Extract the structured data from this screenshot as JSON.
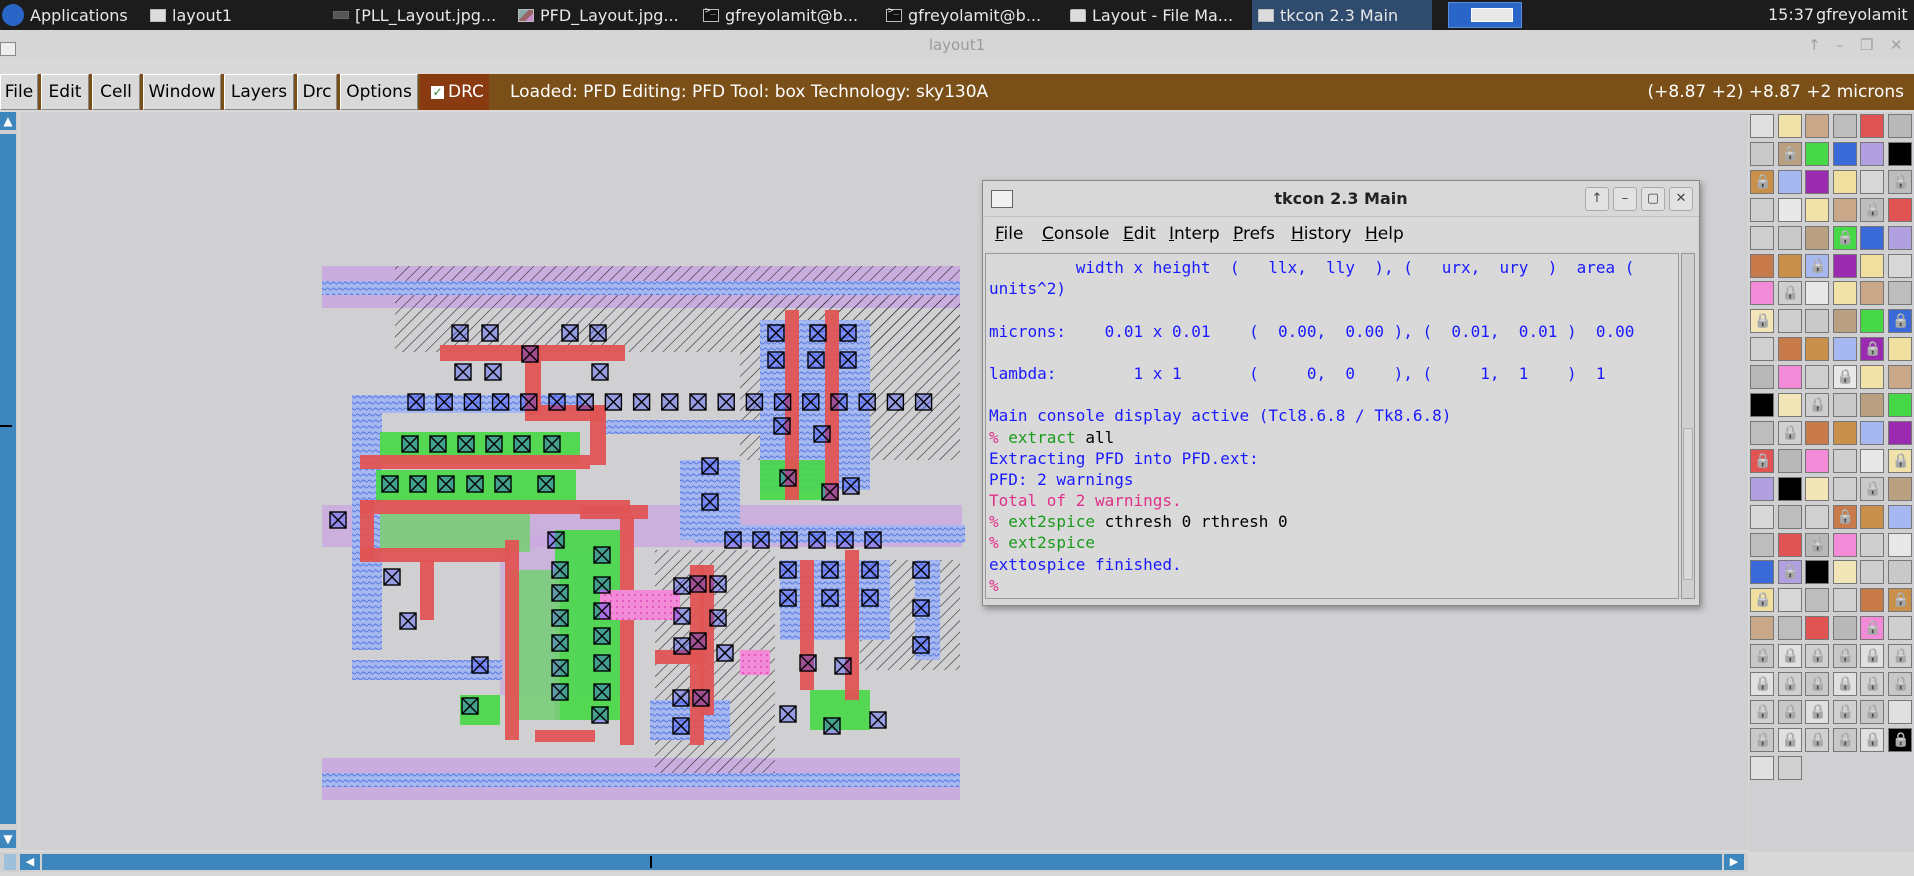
{
  "taskbar": {
    "applications": "Applications",
    "items": [
      {
        "label": "layout1",
        "icon": "window-icon"
      },
      {
        "label": "[PLL_Layout.jpg...",
        "icon": "window-icon"
      },
      {
        "label": "PFD_Layout.jpg...",
        "icon": "image-icon"
      },
      {
        "label": "gfreyolamit@b...",
        "icon": "terminal-icon"
      },
      {
        "label": "gfreyolamit@b...",
        "icon": "terminal-icon"
      },
      {
        "label": "Layout - File Ma...",
        "icon": "folder-icon"
      },
      {
        "label": "tkcon 2.3 Main",
        "icon": "window-icon",
        "active": true
      }
    ],
    "clock": "15:37",
    "user": "gfreyolamit"
  },
  "window": {
    "title": "layout1"
  },
  "menubar": {
    "items": [
      "File",
      "Edit",
      "Cell",
      "Window",
      "Layers",
      "Drc",
      "Options"
    ],
    "drc_label": "DRC",
    "status": "Loaded: PFD Editing: PFD Tool: box  Technology: sky130A",
    "coords": "(+8.87 +2) +8.87 +2 microns"
  },
  "tkcon": {
    "title": "tkcon 2.3 Main",
    "menu": [
      "File",
      "Console",
      "Edit",
      "Interp",
      "Prefs",
      "History",
      "Help"
    ],
    "lines": [
      {
        "segments": [
          {
            "text": "         width x height  (   llx,  lly  ), (   urx,  ury  )  area (",
            "cls": "c-blue"
          }
        ]
      },
      {
        "segments": [
          {
            "text": "units^2)",
            "cls": "c-blue"
          }
        ]
      },
      {
        "segments": [
          {
            "text": "",
            "cls": "c-blue"
          }
        ]
      },
      {
        "segments": [
          {
            "text": "microns:    0.01 x 0.01    (  0.00,  0.00 ), (  0.01,  0.01 )  0.00",
            "cls": "c-blue"
          }
        ]
      },
      {
        "segments": [
          {
            "text": "",
            "cls": "c-blue"
          }
        ]
      },
      {
        "segments": [
          {
            "text": "lambda:        1 x 1       (     0,  0    ), (     1,  1    )  1",
            "cls": "c-blue"
          }
        ]
      },
      {
        "segments": [
          {
            "text": "",
            "cls": "c-blue"
          }
        ]
      },
      {
        "segments": [
          {
            "text": "Main console display active (Tcl8.6.8 / Tk8.6.8)",
            "cls": "c-blue"
          }
        ]
      },
      {
        "segments": [
          {
            "text": "% ",
            "cls": "c-err"
          },
          {
            "text": "extract",
            "cls": "c-cmd"
          },
          {
            "text": " all",
            "cls": "c-blk"
          }
        ]
      },
      {
        "segments": [
          {
            "text": "Extracting PFD into PFD.ext:",
            "cls": "c-blue"
          }
        ]
      },
      {
        "segments": [
          {
            "text": "PFD: 2 warnings",
            "cls": "c-blue"
          }
        ]
      },
      {
        "segments": [
          {
            "text": "Total of 2 warnings.",
            "cls": "c-err"
          }
        ]
      },
      {
        "segments": [
          {
            "text": "% ",
            "cls": "c-err"
          },
          {
            "text": "ext2spice",
            "cls": "c-cmd"
          },
          {
            "text": " cthresh 0 rthresh 0",
            "cls": "c-blk"
          }
        ]
      },
      {
        "segments": [
          {
            "text": "% ",
            "cls": "c-err"
          },
          {
            "text": "ext2spice",
            "cls": "c-cmd"
          }
        ]
      },
      {
        "segments": [
          {
            "text": "exttospice finished.",
            "cls": "c-blue"
          }
        ]
      },
      {
        "segments": [
          {
            "text": "%",
            "cls": "c-err"
          }
        ]
      }
    ]
  },
  "colors": {
    "menubar_bg": "#7a4f18",
    "drc_bg": "#8a3a10",
    "scrollbar": "#3d87be",
    "canvas_bg": "#d0cfd2",
    "taskbar_bg": "#1c1c1c",
    "active_task": "#2f4b6e",
    "tk_output": "#1a1aff",
    "tk_command": "#1a9a1a",
    "tk_prompt": "#e0308a"
  }
}
